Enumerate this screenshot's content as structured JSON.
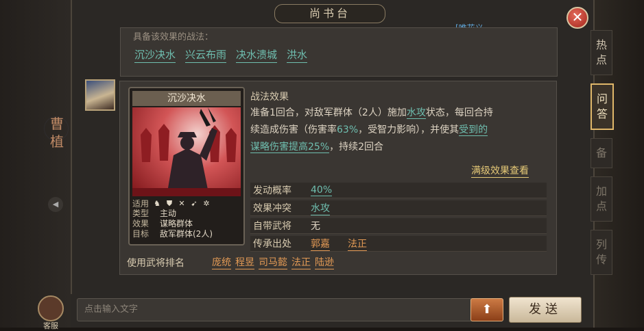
{
  "window": {
    "title": "尚书台",
    "watermark": "[唯花义"
  },
  "related": {
    "caption": "具备该效果的战法：",
    "tactics": [
      "沉沙决水",
      "兴云布雨",
      "决水溃城",
      "洪水"
    ]
  },
  "card": {
    "name": "沉沙决水",
    "suitable_label": "适用",
    "icons": [
      "cavalry-icon",
      "shield-icon",
      "bow-icon",
      "spear-icon",
      "wheel-icon"
    ],
    "rows": [
      {
        "k": "类型",
        "v": "主动"
      },
      {
        "k": "效果",
        "v": "谋略群体"
      },
      {
        "k": "目标",
        "v": "敌军群体(2人)"
      }
    ]
  },
  "effect": {
    "label": "战法效果",
    "line1_a": "准备1回合，对敌军群体（2人）施加",
    "line1_hl": "水攻",
    "line1_b": "状态，每回合持",
    "line2_a": "续造成伤害（伤害率",
    "line2_rate": "63%",
    "line2_b": "，受智力影响），并使其",
    "line2_hl": "受到的",
    "line3_hl": "谋略伤害提高25%",
    "line3_b": "，持续2回合",
    "max_level": "满级效果查看"
  },
  "attrs": {
    "rate_label": "发动概率",
    "rate": "40%",
    "conflict_label": "效果冲突",
    "conflict": "水攻",
    "own_label": "自带武将",
    "own": "无",
    "origin_label": "传承出处",
    "origin": [
      "郭嘉",
      "法正"
    ]
  },
  "users": {
    "label": "使用武将排名",
    "names": [
      "庞统",
      "程昱",
      "司马懿",
      "法正",
      "陆逊"
    ]
  },
  "side_tabs": [
    "热点",
    "问答",
    "备",
    "加点",
    "列传"
  ],
  "left": {
    "char": "曹植",
    "service": "客服"
  },
  "input": {
    "placeholder": "点击输入文字"
  },
  "buttons": {
    "up": "⬆",
    "send": "发送",
    "close": "✕"
  }
}
